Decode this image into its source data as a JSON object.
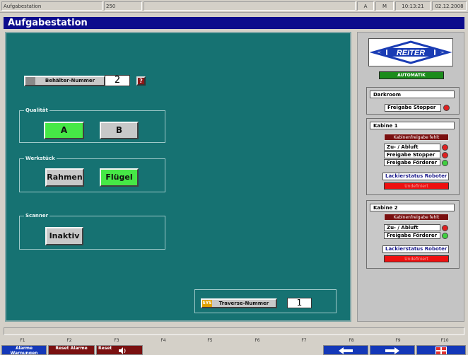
{
  "statusbar": {
    "app": "Aufgabestation",
    "num": "250",
    "mode_a": "A",
    "mode_m": "M",
    "time": "10:13:21",
    "date": "02.12.2008"
  },
  "title": "Aufgabestation",
  "behaelter": {
    "label": "Behälter-Nummer",
    "value": "2",
    "help": "?"
  },
  "qualitaet": {
    "label": "Qualität",
    "a": "A",
    "b": "B",
    "active": "A"
  },
  "werkstueck": {
    "label": "Werkstück",
    "rahmen": "Rahmen",
    "fluegel": "Flügel",
    "active": "Flügel"
  },
  "scanner": {
    "label": "Scanner",
    "button": "Inaktiv"
  },
  "traverse": {
    "sys": "SYS",
    "label": "Traverse-Nummer",
    "value": "1"
  },
  "right": {
    "logo": "REITER",
    "automatik": "AUTOMATIK",
    "darkroom": {
      "title": "Darkroom",
      "freigabe_stopper": "Freigabe Stopper",
      "stopper_color": "#e02020"
    },
    "kabine1": {
      "title": "Kabine 1",
      "fehlt": "Kabinenfreigabe fehlt",
      "zu_abluft": "Zu- / Abluft",
      "freigabe_stopper": "Freigabe Stopper",
      "freigabe_foerderer": "Freigabe Förderer",
      "lackierstatus": "Lackierstatus Roboter 11",
      "status": "Undefiniert",
      "colors": {
        "zu_abluft": "#e02020",
        "stopper": "#e02020",
        "foerderer": "#40d040"
      }
    },
    "kabine2": {
      "title": "Kabine 2",
      "fehlt": "Kabinenfreigabe fehlt",
      "zu_abluft": "Zu- / Abluft",
      "freigabe_foerderer": "Freigabe Förderer",
      "lackierstatus": "Lackierstatus Roboter 21",
      "status": "Undefiniert",
      "colors": {
        "zu_abluft": "#e02020",
        "foerderer": "#40d040"
      }
    }
  },
  "fkeys": [
    "F1",
    "F2",
    "F3",
    "F4",
    "F5",
    "F6",
    "F7",
    "F8",
    "F9",
    "F10"
  ],
  "bottom": {
    "alarme": "Alarme Warnungen",
    "reset_alarme": "Reset Alarme",
    "reset_sound": "Reset",
    "left_arrow": "arrow-left-icon",
    "right_arrow": "arrow-right-icon",
    "grid": "grid-icon"
  },
  "colors": {
    "teal": "#167272",
    "title_bg": "#0c0c8c",
    "active_green": "#46e846",
    "status_red": "#ee1010",
    "dark_red": "#7a1010"
  }
}
